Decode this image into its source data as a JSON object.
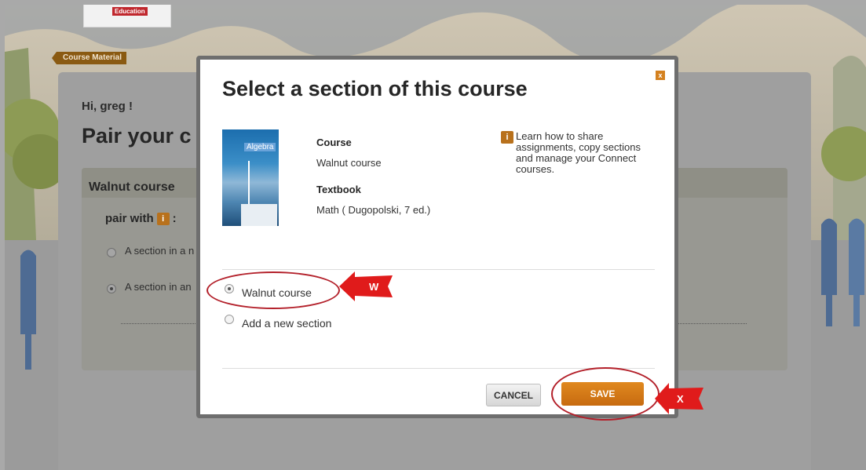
{
  "header": {
    "logo_text": "Education"
  },
  "breadcrumb": {
    "label": "Course Material"
  },
  "page": {
    "greeting": "Hi, greg !",
    "title": "Pair your c",
    "course_box": {
      "title": "Walnut course",
      "pair_with_label": "pair with",
      "pair_with_suffix": ":",
      "options": [
        {
          "label": "A section in a n",
          "selected": false
        },
        {
          "label": "A section in an",
          "selected": true
        }
      ]
    }
  },
  "modal": {
    "title": "Select a section of this course",
    "close_label": "x",
    "book_cover_title": "Algebra",
    "course_label": "Course",
    "course_value": "Walnut course",
    "textbook_label": "Textbook",
    "textbook_value": "Math ( Dugopolski, 7 ed.)",
    "help_icon": "i",
    "help_text": "Learn how to share assignments, copy sections and manage your Connect courses.",
    "sections": [
      {
        "label": "Walnut course",
        "selected": true
      },
      {
        "label": "Add a new section",
        "selected": false
      }
    ],
    "cancel_label": "CANCEL",
    "save_label": "SAVE"
  },
  "annotations": {
    "callout_w": "W",
    "callout_x": "X",
    "callout_color": "#e01b1b",
    "ring_color": "#b3202a"
  },
  "colors": {
    "accent_orange": "#d4811f",
    "dialog_border": "#6e6e6e"
  }
}
